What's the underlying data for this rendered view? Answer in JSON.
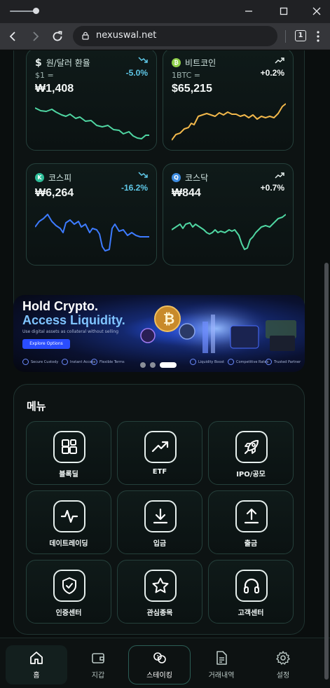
{
  "browser": {
    "url": "nexuswal.net",
    "tab_count": "1"
  },
  "market": {
    "cards": [
      {
        "name": "원/달러 환율",
        "sub": "$1 =",
        "price": "₩1,408",
        "change": "-5.0%",
        "trend": "down",
        "icon": "dollar-icon",
        "color": "#4fd6a2"
      },
      {
        "name": "비트코인",
        "sub": "1BTC =",
        "price": "$65,215",
        "change": "+0.2%",
        "trend": "up",
        "icon": "bitcoin-icon",
        "color": "#f2b84b"
      },
      {
        "name": "코스피",
        "sub": "",
        "price": "₩6,264",
        "change": "-16.2%",
        "trend": "down",
        "icon": "kospi-icon",
        "color": "#3d7bff"
      },
      {
        "name": "코스닥",
        "sub": "",
        "price": "₩844",
        "change": "+0.7%",
        "trend": "up",
        "icon": "kosdaq-icon",
        "color": "#4fd6a2"
      }
    ]
  },
  "banner": {
    "title_line1": "Hold Crypto.",
    "title_line2": "Access Liquidity.",
    "tagline": "Use digital assets as collateral without selling",
    "cta": "Explore Options",
    "features": [
      "Secure Custody",
      "Instant Access",
      "Flexible Terms",
      "Liquidity Boost",
      "Competitive Rates",
      "Trusted Partner"
    ],
    "active_slide": 3,
    "slides": 3
  },
  "menu": {
    "title": "메뉴",
    "items": [
      {
        "label": "블록딜",
        "icon": "blocks-icon"
      },
      {
        "label": "ETF",
        "icon": "trending-up-icon"
      },
      {
        "label": "IPO/공모",
        "icon": "rocket-icon"
      },
      {
        "label": "데이트레이딩",
        "icon": "pulse-icon"
      },
      {
        "label": "입금",
        "icon": "download-icon"
      },
      {
        "label": "출금",
        "icon": "upload-icon"
      },
      {
        "label": "인증센터",
        "icon": "shield-check-icon"
      },
      {
        "label": "관심종목",
        "icon": "star-icon"
      },
      {
        "label": "고객센터",
        "icon": "headphones-icon"
      }
    ]
  },
  "bottom_nav": {
    "items": [
      {
        "label": "홈",
        "icon": "home-icon",
        "active": true
      },
      {
        "label": "지갑",
        "icon": "wallet-icon"
      },
      {
        "label": "스테이킹",
        "icon": "coins-icon"
      },
      {
        "label": "거래내역",
        "icon": "document-icon"
      },
      {
        "label": "설정",
        "icon": "gear-icon"
      }
    ]
  }
}
